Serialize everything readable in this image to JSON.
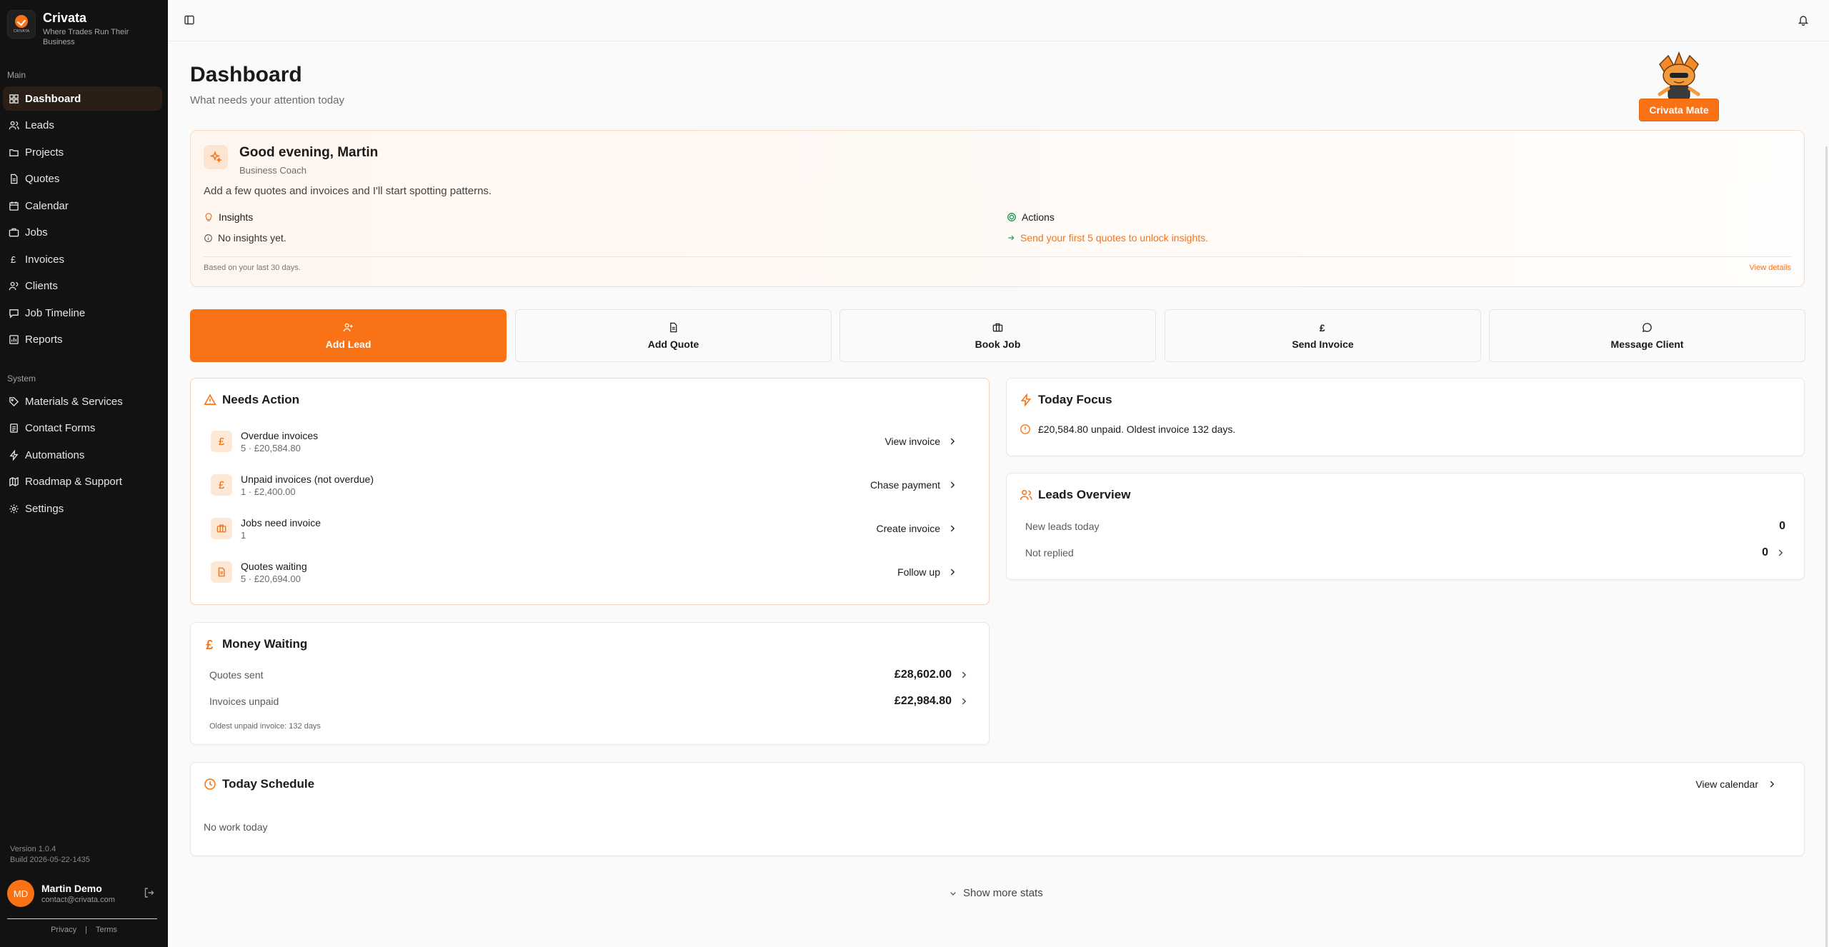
{
  "brand": {
    "name": "Crivata",
    "tagline": "Where Trades Run Their Business",
    "logo_small": "CRIVATA"
  },
  "sidebar": {
    "main_label": "Main",
    "main_items": [
      {
        "label": "Dashboard",
        "icon": "grid-icon",
        "active": true
      },
      {
        "label": "Leads",
        "icon": "users-icon"
      },
      {
        "label": "Projects",
        "icon": "folder-icon"
      },
      {
        "label": "Quotes",
        "icon": "file-icon"
      },
      {
        "label": "Calendar",
        "icon": "calendar-icon"
      },
      {
        "label": "Jobs",
        "icon": "briefcase-icon"
      },
      {
        "label": "Invoices",
        "icon": "pound-icon"
      },
      {
        "label": "Clients",
        "icon": "clients-icon"
      },
      {
        "label": "Job Timeline",
        "icon": "chat-icon"
      },
      {
        "label": "Reports",
        "icon": "chart-icon"
      }
    ],
    "system_label": "System",
    "system_items": [
      {
        "label": "Materials & Services",
        "icon": "tag-icon"
      },
      {
        "label": "Contact Forms",
        "icon": "form-icon"
      },
      {
        "label": "Automations",
        "icon": "bolt-icon"
      },
      {
        "label": "Roadmap & Support",
        "icon": "map-icon"
      },
      {
        "label": "Settings",
        "icon": "gear-icon"
      }
    ],
    "version": "Version 1.0.4",
    "build": "Build 2026-05-22-1435",
    "user": {
      "initials": "MD",
      "name": "Martin Demo",
      "email": "contact@crivata.com"
    },
    "privacy": "Privacy",
    "sep": "|",
    "terms": "Terms"
  },
  "header": {
    "title": "Dashboard",
    "subtitle": "What needs your attention today",
    "mate_label": "Crivata Mate"
  },
  "coach": {
    "greeting": "Good evening, Martin",
    "role": "Business Coach",
    "message": "Add a few quotes and invoices and I'll start spotting patterns.",
    "insights_label": "Insights",
    "insights_value": "No insights yet.",
    "actions_label": "Actions",
    "actions_value": "Send your first 5 quotes to unlock insights.",
    "footnote": "Based on your last 30 days.",
    "view_details": "View details"
  },
  "quick_actions": [
    {
      "label": "Add Lead",
      "icon": "user-plus-icon",
      "primary": true
    },
    {
      "label": "Add Quote",
      "icon": "file-icon"
    },
    {
      "label": "Book Job",
      "icon": "briefcase-icon"
    },
    {
      "label": "Send Invoice",
      "icon": "pound-icon"
    },
    {
      "label": "Message Client",
      "icon": "message-icon"
    }
  ],
  "needs_action": {
    "title": "Needs Action",
    "rows": [
      {
        "title": "Overdue invoices",
        "sub": "5 · £20,584.80",
        "action": "View invoice",
        "icon": "£"
      },
      {
        "title": "Unpaid invoices (not overdue)",
        "sub": "1 · £2,400.00",
        "action": "Chase payment",
        "icon": "£"
      },
      {
        "title": "Jobs need invoice",
        "sub": "1",
        "action": "Create invoice",
        "icon": "briefcase"
      },
      {
        "title": "Quotes waiting",
        "sub": "5 · £20,694.00",
        "action": "Follow up",
        "icon": "file"
      }
    ]
  },
  "money_waiting": {
    "title": "Money Waiting",
    "quotes_label": "Quotes sent",
    "quotes_value": "£28,602.00",
    "invoices_label": "Invoices unpaid",
    "invoices_value": "£22,984.80",
    "oldest": "Oldest unpaid invoice: 132 days"
  },
  "today_focus": {
    "title": "Today Focus",
    "text": "£20,584.80 unpaid. Oldest invoice 132 days."
  },
  "leads_overview": {
    "title": "Leads Overview",
    "new_label": "New leads today",
    "new_value": "0",
    "notreplied_label": "Not replied",
    "notreplied_value": "0"
  },
  "schedule": {
    "title": "Today Schedule",
    "link": "View calendar",
    "empty": "No work today"
  },
  "show_more": "Show more stats",
  "colors": {
    "accent": "#f97316",
    "sidebar_bg": "#121212",
    "active_bg": "#2a1e16"
  }
}
